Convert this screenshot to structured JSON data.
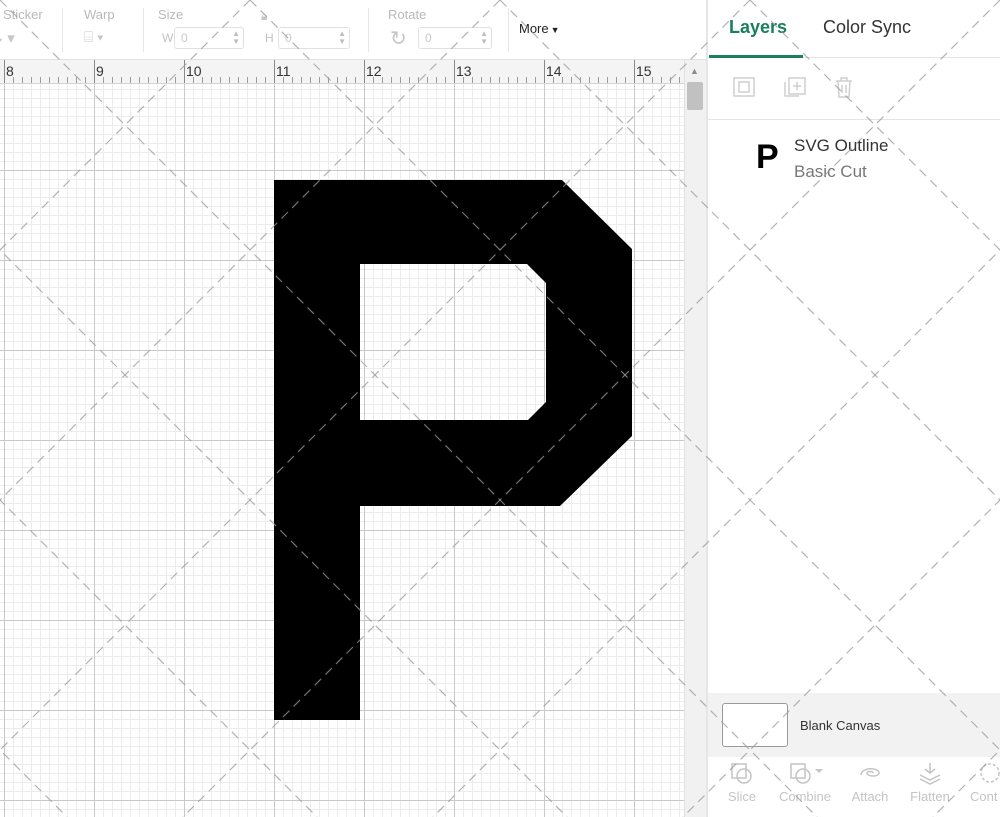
{
  "toolbar": {
    "sticker_label": "Sticker",
    "warp_label": "Warp",
    "size_label": "Size",
    "width_prefix": "W",
    "width_value": "0",
    "height_prefix": "H",
    "height_value": "0",
    "rotate_label": "Rotate",
    "rotate_value": "0",
    "more_label": "More"
  },
  "ruler": {
    "numbers": [
      "8",
      "9",
      "10",
      "11",
      "12",
      "13",
      "14",
      "15"
    ]
  },
  "canvas": {
    "letter_color": "#000000",
    "grid_major_color": "#c9c9c9",
    "grid_minor_color": "#ececec"
  },
  "panel": {
    "tabs": [
      {
        "label": "Layers",
        "active": true
      },
      {
        "label": "Color Sync",
        "active": false
      }
    ],
    "accent_color": "#1a7f5c",
    "tools": [
      "group-icon",
      "duplicate-icon",
      "delete-icon"
    ],
    "layers": [
      {
        "thumb": "P",
        "name": "SVG Outline",
        "operation": "Basic Cut"
      }
    ],
    "blank_canvas_label": "Blank Canvas",
    "bottom_tools": [
      {
        "label": "Slice",
        "icon": "slice-icon"
      },
      {
        "label": "Combine",
        "icon": "combine-icon"
      },
      {
        "label": "Attach",
        "icon": "attach-icon"
      },
      {
        "label": "Flatten",
        "icon": "flatten-icon"
      },
      {
        "label": "Cont",
        "icon": "contour-icon"
      }
    ]
  }
}
